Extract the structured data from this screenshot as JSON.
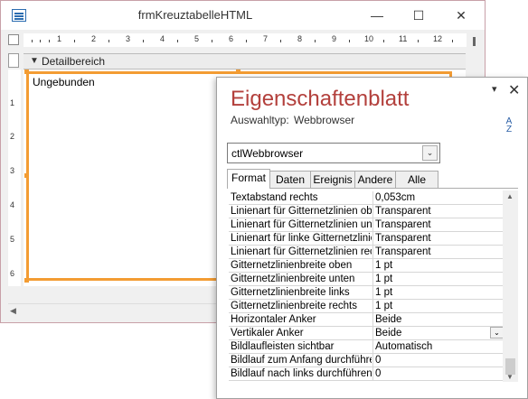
{
  "form_window": {
    "title": "frmKreuztabelleHTML",
    "min_glyph": "—",
    "max_glyph": "☐",
    "close_glyph": "✕",
    "ruler_numbers": [
      "1",
      "2",
      "3",
      "4",
      "5",
      "6",
      "7",
      "8",
      "9",
      "10",
      "11",
      "12"
    ],
    "left_ruler_numbers": [
      "1",
      "2",
      "3",
      "4",
      "5",
      "6"
    ],
    "section_label": "Detailbereich",
    "section_icon": "▼",
    "control_label": "Ungebunden"
  },
  "property_sheet": {
    "title": "Eigenschaftenblatt",
    "pin_glyph": "▾",
    "close_glyph": "✕",
    "selection_type_label": "Auswahltyp:",
    "selection_type_value": "Webbrowser",
    "sort_glyph_top": "A",
    "sort_glyph_bottom": "Z",
    "object_combo_value": "ctlWebbrowser",
    "combo_arrow": "⌄",
    "tabs": [
      {
        "label": "Format",
        "active": true
      },
      {
        "label": "Daten",
        "active": false
      },
      {
        "label": "Ereignis",
        "active": false
      },
      {
        "label": "Andere",
        "active": false
      },
      {
        "label": "Alle",
        "active": false
      }
    ],
    "properties": [
      {
        "name": "Textabstand rechts",
        "value": "0,053cm"
      },
      {
        "name": "Linienart für Gitternetzlinien oben",
        "value": "Transparent"
      },
      {
        "name": "Linienart für Gitternetzlinien unten",
        "value": "Transparent"
      },
      {
        "name": "Linienart für linke Gitternetzlinie",
        "value": "Transparent"
      },
      {
        "name": "Linienart für Gitternetzlinien rechts",
        "value": "Transparent"
      },
      {
        "name": "Gitternetzlinienbreite oben",
        "value": "1 pt"
      },
      {
        "name": "Gitternetzlinienbreite unten",
        "value": "1 pt"
      },
      {
        "name": "Gitternetzlinienbreite links",
        "value": "1 pt"
      },
      {
        "name": "Gitternetzlinienbreite rechts",
        "value": "1 pt"
      },
      {
        "name": "Horizontaler Anker",
        "value": "Beide"
      },
      {
        "name": "Vertikaler Anker",
        "value": "Beide"
      },
      {
        "name": "Bildlaufleisten sichtbar",
        "value": "Automatisch"
      },
      {
        "name": "Bildlauf zum Anfang durchführen",
        "value": "0"
      },
      {
        "name": "Bildlauf nach links durchführen",
        "value": "0"
      }
    ],
    "row_dropdown_glyph": "⌄",
    "scroll_up": "▲",
    "scroll_down": "▼"
  },
  "colors": {
    "accent_title": "#b3403c",
    "selection_orange": "#f39c33"
  }
}
